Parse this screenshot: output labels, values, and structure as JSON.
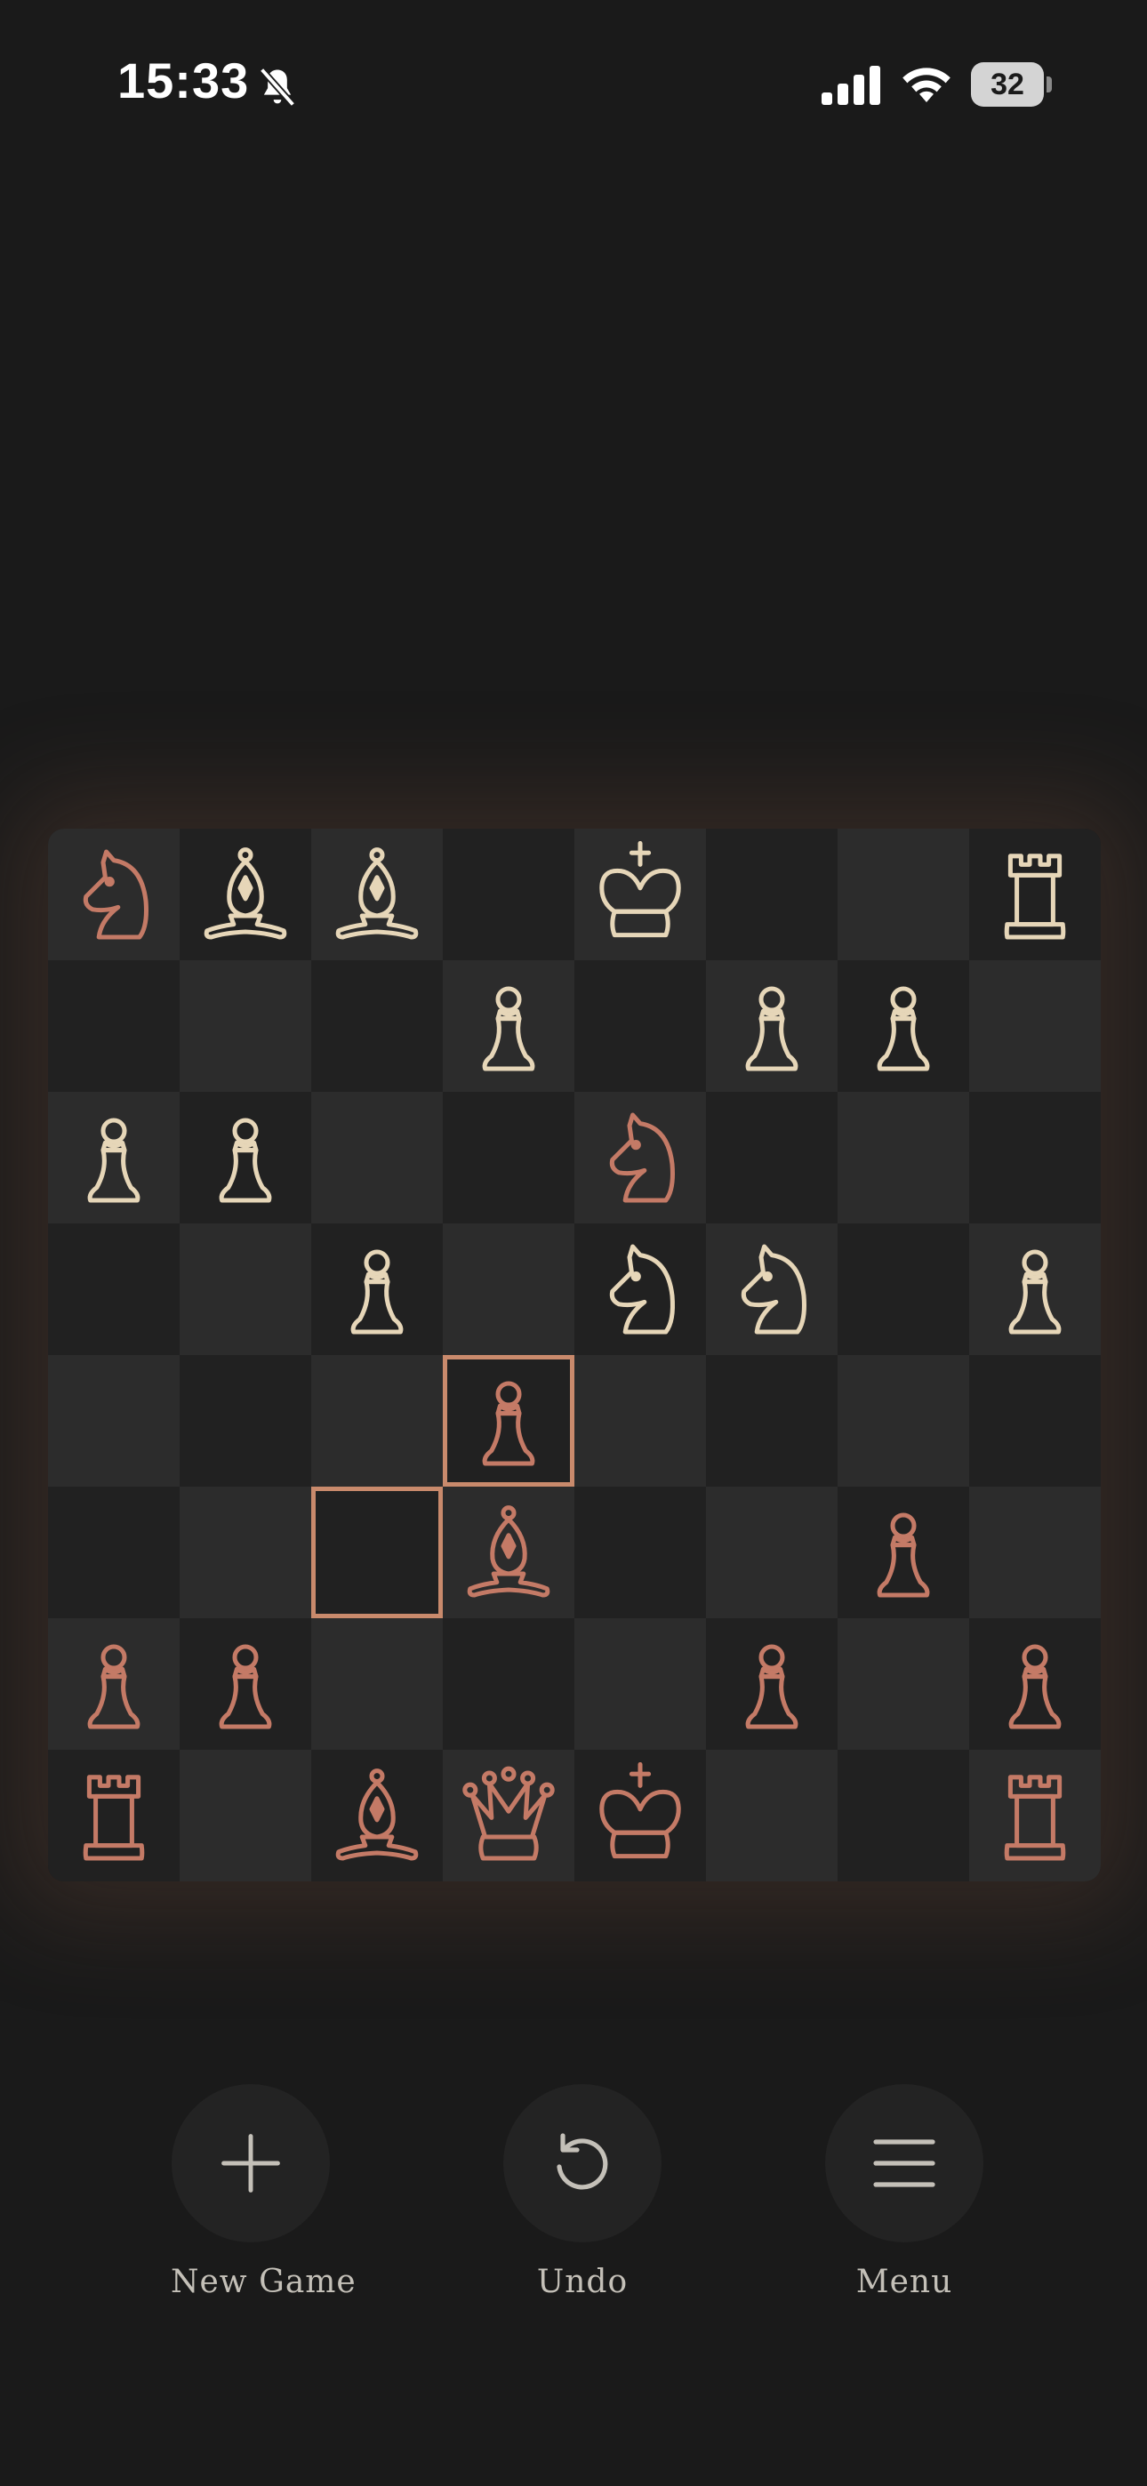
{
  "status": {
    "time": "15:33",
    "battery": "32"
  },
  "colors": {
    "background": "#1a1a1a",
    "light_square": "#2c2c2c",
    "dark_square": "#212121",
    "white_piece": "#e6d6b8",
    "black_piece": "#c47a66",
    "highlight": "#c98a6c"
  },
  "board": {
    "highlight": [
      "d4",
      "c3"
    ],
    "pieces": [
      {
        "sq": "a8",
        "t": "knight",
        "c": "black"
      },
      {
        "sq": "b8",
        "t": "bishop",
        "c": "white"
      },
      {
        "sq": "c8",
        "t": "bishop",
        "c": "white"
      },
      {
        "sq": "e8",
        "t": "king",
        "c": "white"
      },
      {
        "sq": "h8",
        "t": "rook",
        "c": "white"
      },
      {
        "sq": "d7",
        "t": "pawn",
        "c": "white"
      },
      {
        "sq": "f7",
        "t": "pawn",
        "c": "white"
      },
      {
        "sq": "g7",
        "t": "pawn",
        "c": "white"
      },
      {
        "sq": "a6",
        "t": "pawn",
        "c": "white"
      },
      {
        "sq": "b6",
        "t": "pawn",
        "c": "white"
      },
      {
        "sq": "e6",
        "t": "knight",
        "c": "black"
      },
      {
        "sq": "c5",
        "t": "pawn",
        "c": "white"
      },
      {
        "sq": "e5",
        "t": "knight",
        "c": "white"
      },
      {
        "sq": "f5",
        "t": "knight",
        "c": "white"
      },
      {
        "sq": "h5",
        "t": "pawn",
        "c": "white"
      },
      {
        "sq": "d4",
        "t": "pawn",
        "c": "black"
      },
      {
        "sq": "d3",
        "t": "bishop",
        "c": "black"
      },
      {
        "sq": "g3",
        "t": "pawn",
        "c": "black"
      },
      {
        "sq": "a2",
        "t": "pawn",
        "c": "black"
      },
      {
        "sq": "b2",
        "t": "pawn",
        "c": "black"
      },
      {
        "sq": "f2",
        "t": "pawn",
        "c": "black"
      },
      {
        "sq": "h2",
        "t": "pawn",
        "c": "black"
      },
      {
        "sq": "a1",
        "t": "rook",
        "c": "black"
      },
      {
        "sq": "c1",
        "t": "bishop",
        "c": "black"
      },
      {
        "sq": "d1",
        "t": "queen",
        "c": "black"
      },
      {
        "sq": "e1",
        "t": "king",
        "c": "black"
      },
      {
        "sq": "h1",
        "t": "rook",
        "c": "black"
      }
    ]
  },
  "controls": {
    "new_game": "New Game",
    "undo": "Undo",
    "menu": "Menu"
  }
}
